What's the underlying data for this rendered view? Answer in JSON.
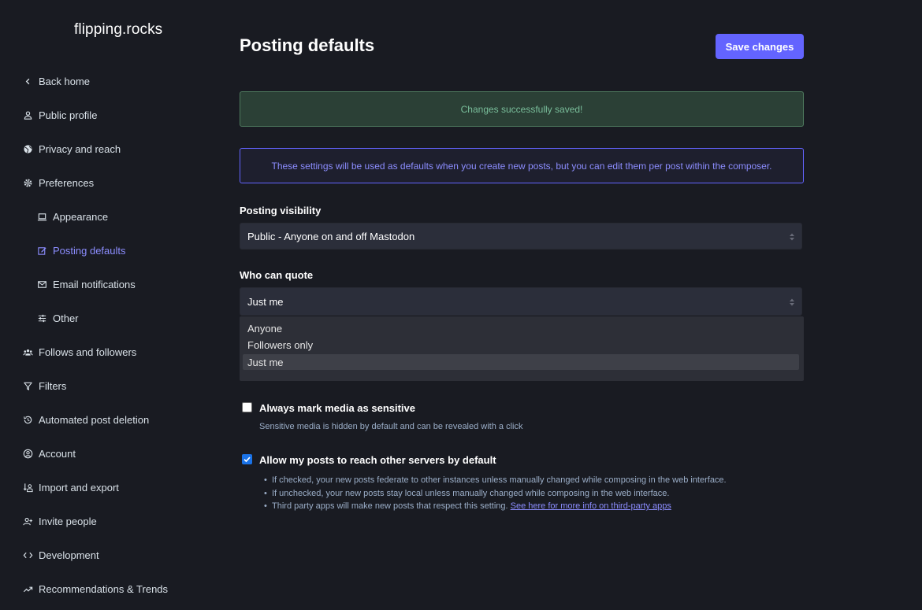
{
  "site": {
    "name": "flipping.rocks"
  },
  "nav": {
    "items": [
      {
        "label": "Back home",
        "icon": "chevron-left-icon"
      },
      {
        "label": "Public profile",
        "icon": "person-icon"
      },
      {
        "label": "Privacy and reach",
        "icon": "globe-icon"
      },
      {
        "label": "Preferences",
        "icon": "gear-icon"
      },
      {
        "label": "Appearance",
        "icon": "laptop-icon"
      },
      {
        "label": "Posting defaults",
        "icon": "edit-icon"
      },
      {
        "label": "Email notifications",
        "icon": "mail-icon"
      },
      {
        "label": "Other",
        "icon": "sliders-icon"
      },
      {
        "label": "Follows and followers",
        "icon": "group-icon"
      },
      {
        "label": "Filters",
        "icon": "filter-icon"
      },
      {
        "label": "Automated post deletion",
        "icon": "history-icon"
      },
      {
        "label": "Account",
        "icon": "account-circle-icon"
      },
      {
        "label": "Import and export",
        "icon": "import-export-icon"
      },
      {
        "label": "Invite people",
        "icon": "person-add-icon"
      },
      {
        "label": "Development",
        "icon": "code-icon"
      },
      {
        "label": "Recommendations & Trends",
        "icon": "trending-icon"
      }
    ],
    "active": "Posting defaults"
  },
  "page": {
    "title": "Posting defaults",
    "save_label": "Save changes",
    "flash": "Changes successfully saved!",
    "info": "These settings will be used as defaults when you create new posts, but you can edit them per post within the composer."
  },
  "visibility": {
    "label": "Posting visibility",
    "value": "Public - Anyone on and off Mastodon"
  },
  "quote": {
    "label": "Who can quote",
    "value": "Just me",
    "options": [
      "Anyone",
      "Followers only",
      "Just me"
    ],
    "selected_index": 2
  },
  "sensitive": {
    "label": "Always mark media as sensitive",
    "hint": "Sensitive media is hidden by default and can be revealed with a click",
    "checked": false
  },
  "federate": {
    "label": "Allow my posts to reach other servers by default",
    "checked": true,
    "bullets": [
      "If checked, your new posts federate to other instances unless manually changed while composing in the web interface.",
      "If unchecked, your new posts stay local unless manually changed while composing in the web interface.",
      "Third party apps will make new posts that respect this setting."
    ],
    "link_text": "See here for more info on third-party apps"
  },
  "colors": {
    "background": "#191b22",
    "accent": "#6364ff",
    "success_text": "#79bd9a",
    "info_text": "#8c8dff"
  }
}
